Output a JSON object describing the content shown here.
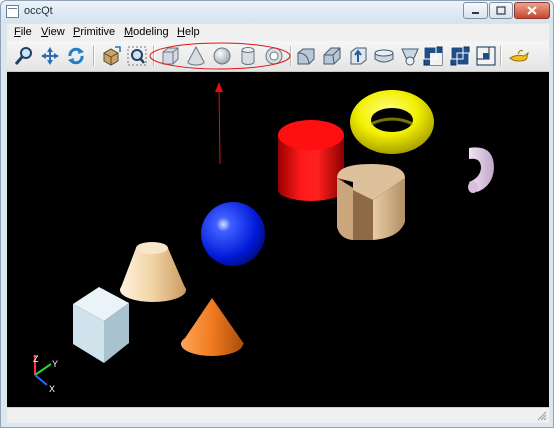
{
  "window": {
    "title": "occQt"
  },
  "menu": {
    "items": [
      {
        "label": "File"
      },
      {
        "label": "View"
      },
      {
        "label": "Primitive"
      },
      {
        "label": "Modeling"
      },
      {
        "label": "Help"
      }
    ]
  },
  "toolbar": {
    "view_group": [
      "zoom-icon",
      "pan-icon",
      "rotate-icon"
    ],
    "fit_group": [
      "reset-view-icon",
      "fit-all-icon"
    ],
    "primitive_group": [
      "box-icon",
      "cone-icon",
      "sphere-icon",
      "cylinder-icon",
      "torus-icon"
    ],
    "modeling_group": [
      "fillet-icon",
      "chamfer-icon",
      "extrude-icon",
      "revolve-icon",
      "loft-icon"
    ],
    "boolean_group": [
      "cut-icon",
      "fuse-icon",
      "common-icon"
    ],
    "help_group": [
      "about-icon"
    ]
  },
  "annotation": {
    "highlight_color": "#e01010",
    "highlights": "primitive_group"
  },
  "viewport": {
    "background": "#000000",
    "axes": {
      "labels": [
        "Z",
        "Y",
        "X"
      ],
      "colors": [
        "#ff3030",
        "#30d030",
        "#3060ff"
      ]
    }
  }
}
